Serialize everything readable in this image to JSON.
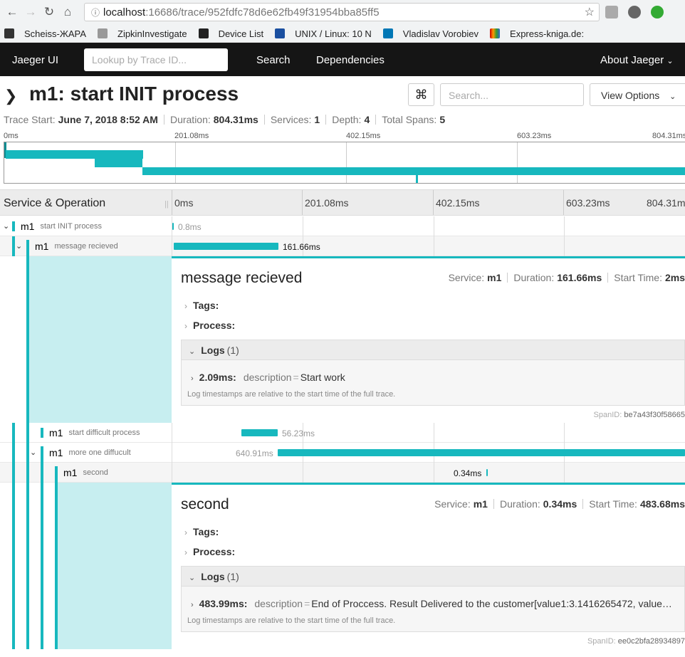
{
  "browser": {
    "url_host": "localhost",
    "url_path": ":16686/trace/952fdfc78d6e62fb49f31954bba85ff5",
    "bookmarks": [
      "Scheiss-ЖАРА",
      "ZipkinInvestigate",
      "Device List",
      "UNIX / Linux: 10 N",
      "Vladislav Vorobiev",
      "Express-kniga.de:"
    ]
  },
  "topnav": {
    "brand": "Jaeger UI",
    "lookup_placeholder": "Lookup by Trace ID...",
    "search": "Search",
    "dependencies": "Dependencies",
    "about": "About Jaeger"
  },
  "header": {
    "title": "m1: start INIT process",
    "search_placeholder": "Search...",
    "view_options": "View Options",
    "meta": {
      "trace_start_label": "Trace Start:",
      "trace_start": "June 7, 2018 8:52 AM",
      "duration_label": "Duration:",
      "duration": "804.31ms",
      "services_label": "Services:",
      "services": "1",
      "depth_label": "Depth:",
      "depth": "4",
      "total_spans_label": "Total Spans:",
      "total_spans": "5"
    }
  },
  "ticks": [
    "0ms",
    "201.08ms",
    "402.15ms",
    "603.23ms",
    "804.31ms"
  ],
  "column_header": "Service & Operation",
  "rows": [
    {
      "service": "m1",
      "operation": "start INIT process",
      "label": "0.8ms"
    },
    {
      "service": "m1",
      "operation": "message recieved",
      "label": "161.66ms"
    },
    {
      "service": "m1",
      "operation": "start difficult process",
      "label": "56.23ms"
    },
    {
      "service": "m1",
      "operation": "more one diffucult",
      "label": "640.91ms"
    },
    {
      "service": "m1",
      "operation": "second",
      "label": "0.34ms"
    }
  ],
  "detail1": {
    "title": "message recieved",
    "service_label": "Service:",
    "service": "m1",
    "duration_label": "Duration:",
    "duration": "161.66ms",
    "start_label": "Start Time:",
    "start": "2ms",
    "tags": "Tags:",
    "process": "Process:",
    "logs": "Logs",
    "logs_count": "(1)",
    "log_time": "2.09ms:",
    "log_key": "description",
    "log_val": "Start work",
    "note": "Log timestamps are relative to the start time of the full trace.",
    "spanid_label": "SpanID:",
    "spanid": "be7a43f30f58665"
  },
  "detail2": {
    "title": "second",
    "service_label": "Service:",
    "service": "m1",
    "duration_label": "Duration:",
    "duration": "0.34ms",
    "start_label": "Start Time:",
    "start": "483.68ms",
    "tags": "Tags:",
    "process": "Process:",
    "logs": "Logs",
    "logs_count": "(1)",
    "log_time": "483.99ms:",
    "log_key": "description",
    "log_val": "End of Proccess. Result Delivered to the customer[value1:3.1416265472, value…",
    "note": "Log timestamps are relative to the start time of the full trace.",
    "spanid_label": "SpanID:",
    "spanid": "ee0c2bfa28934897"
  },
  "colors": {
    "accent": "#17b8be",
    "accent_light": "#c7eef0",
    "nav_bg": "#151515"
  }
}
